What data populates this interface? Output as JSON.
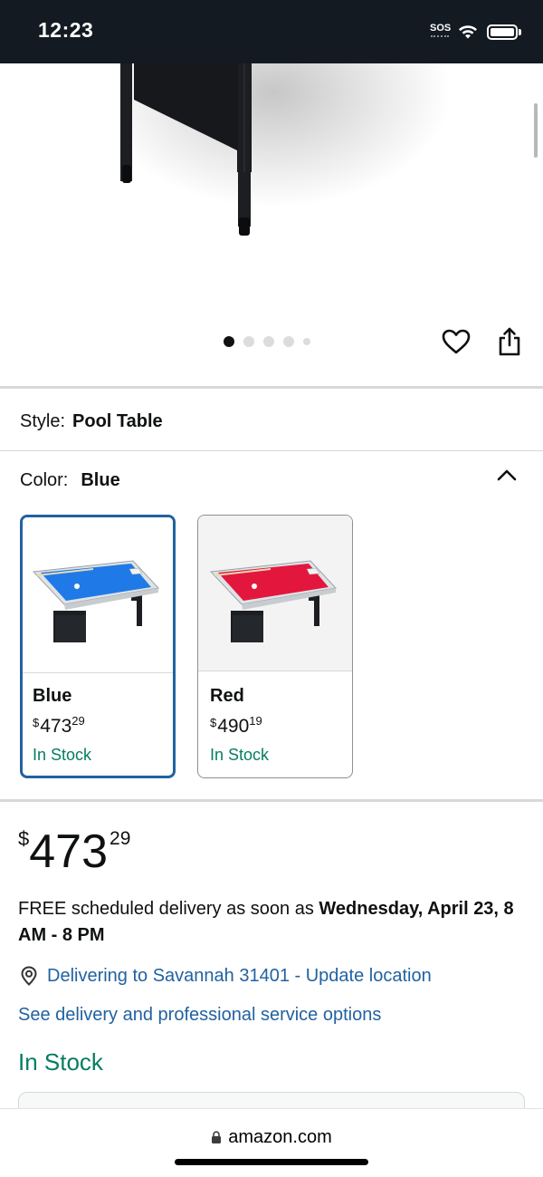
{
  "status_bar": {
    "time": "12:23",
    "sos": "SOS",
    "icons": [
      "wifi-icon",
      "battery-icon"
    ]
  },
  "gallery": {
    "page_count": 5,
    "active_index": 0,
    "icons": [
      "heart-icon",
      "share-icon"
    ]
  },
  "style_selector": {
    "label": "Style:",
    "value": "Pool Table"
  },
  "color_selector": {
    "label": "Color:",
    "value": "Blue",
    "options": [
      {
        "name": "Blue",
        "price_symbol": "$",
        "price_whole": "473",
        "price_fraction": "29",
        "stock": "In Stock",
        "table_color": "#1f7ae8",
        "selected": true
      },
      {
        "name": "Red",
        "price_symbol": "$",
        "price_whole": "490",
        "price_fraction": "19",
        "stock": "In Stock",
        "table_color": "#e3173e",
        "selected": false
      }
    ]
  },
  "price": {
    "symbol": "$",
    "whole": "473",
    "fraction": "29"
  },
  "delivery": {
    "prefix": "FREE scheduled delivery as soon as ",
    "date": "Wednesday, April 23, 8 AM - 8 PM",
    "location_link": "Delivering to Savannah 31401 - Update location",
    "service_link": "See delivery and professional service options"
  },
  "availability": "In Stock",
  "browser": {
    "url": "amazon.com"
  },
  "colors": {
    "link": "#2162a1",
    "in_stock": "#067d62",
    "selected_border": "#2162a1",
    "status_bar_bg": "#131a22"
  }
}
